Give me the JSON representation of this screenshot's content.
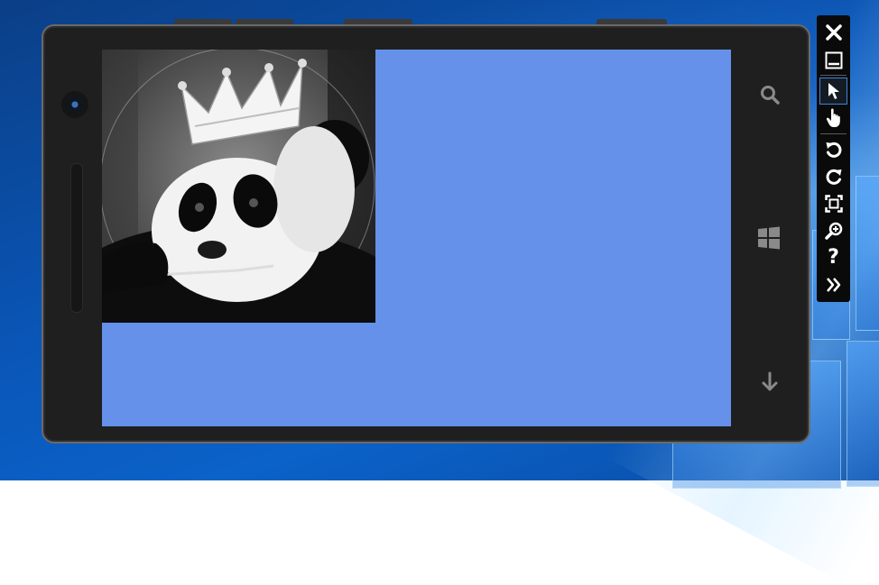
{
  "desktop": {
    "wallpaper": "windows-10-hero"
  },
  "emulator": {
    "screen": {
      "background_color": "#6591ea",
      "image": {
        "subject": "panda-wearing-crown-icon"
      }
    },
    "hardware_keys": [
      "search-icon",
      "windows-start-icon",
      "back-arrow-icon"
    ]
  },
  "toolbar": {
    "buttons": [
      {
        "name": "close-button",
        "icon": "close-icon"
      },
      {
        "name": "minimize-button",
        "icon": "minimize-icon"
      },
      {
        "name": "single-point-mouse-input-button",
        "icon": "cursor-arrow-icon",
        "selected": true
      },
      {
        "name": "single-point-touch-input-button",
        "icon": "hand-pointer-icon"
      },
      {
        "name": "rotate-left-button",
        "icon": "rotate-left-icon"
      },
      {
        "name": "rotate-right-button",
        "icon": "rotate-right-icon"
      },
      {
        "name": "fit-to-screen-button",
        "icon": "fit-screen-icon"
      },
      {
        "name": "zoom-button",
        "icon": "zoom-in-icon"
      },
      {
        "name": "help-button",
        "icon": "help-icon",
        "label": "?"
      },
      {
        "name": "additional-tools-button",
        "icon": "double-chevron-right-icon"
      }
    ]
  }
}
